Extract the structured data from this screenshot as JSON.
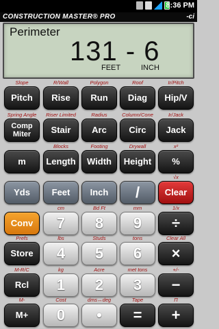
{
  "status": {
    "time": "8:36 PM"
  },
  "app": {
    "title": "CONSTRUCTION MASTER® PRO",
    "logo": "-ci"
  },
  "display": {
    "label": "Perimeter",
    "value": "131 - 6",
    "unit1": "FEET",
    "unit2": "INCH"
  },
  "rows": [
    {
      "sec": [
        "Slope",
        "R/Wall",
        "Polygon",
        "Roof",
        "Ir/Pitch"
      ],
      "keys": [
        "Pitch",
        "Rise",
        "Run",
        "Diag",
        "Hip/V"
      ]
    },
    {
      "sec": [
        "Spring Angle",
        "Riser Limited",
        "Radius",
        "Column/Cone",
        "Ir/Jack"
      ],
      "keys": [
        "Comp Miter",
        "Stair",
        "Arc",
        "Circ",
        "Jack"
      ]
    },
    {
      "sec": [
        "",
        "Blocks",
        "Footing",
        "Drywall",
        "x²"
      ],
      "keys": [
        "m",
        "Length",
        "Width",
        "Height",
        "%"
      ]
    },
    {
      "sec": [
        "",
        "",
        "",
        "",
        "√x"
      ],
      "keys": [
        "Yds",
        "Feet",
        "Inch",
        "/",
        "Clear"
      ]
    },
    {
      "sec": [
        "",
        "cm",
        "Bd Ft",
        "mm",
        "1/x"
      ],
      "keys": [
        "Conv",
        "7",
        "8",
        "9",
        "÷"
      ]
    },
    {
      "sec": [
        "Prefs",
        "lbs",
        "Studs",
        "tons",
        "Clear All"
      ],
      "keys": [
        "Store",
        "4",
        "5",
        "6",
        "×"
      ]
    },
    {
      "sec": [
        "M-R/C",
        "kg",
        "Acre",
        "met tons",
        "+/-"
      ],
      "keys": [
        "Rcl",
        "1",
        "2",
        "3",
        "−"
      ]
    },
    {
      "sec": [
        "M-",
        "Cost",
        "dms↔deg",
        "Tape",
        "Π"
      ],
      "keys": [
        "M+",
        "0",
        "•",
        "=",
        "+"
      ]
    }
  ],
  "colors": {
    "accent_clear": "#d0202a",
    "accent_conv": "#ee8f1c"
  }
}
